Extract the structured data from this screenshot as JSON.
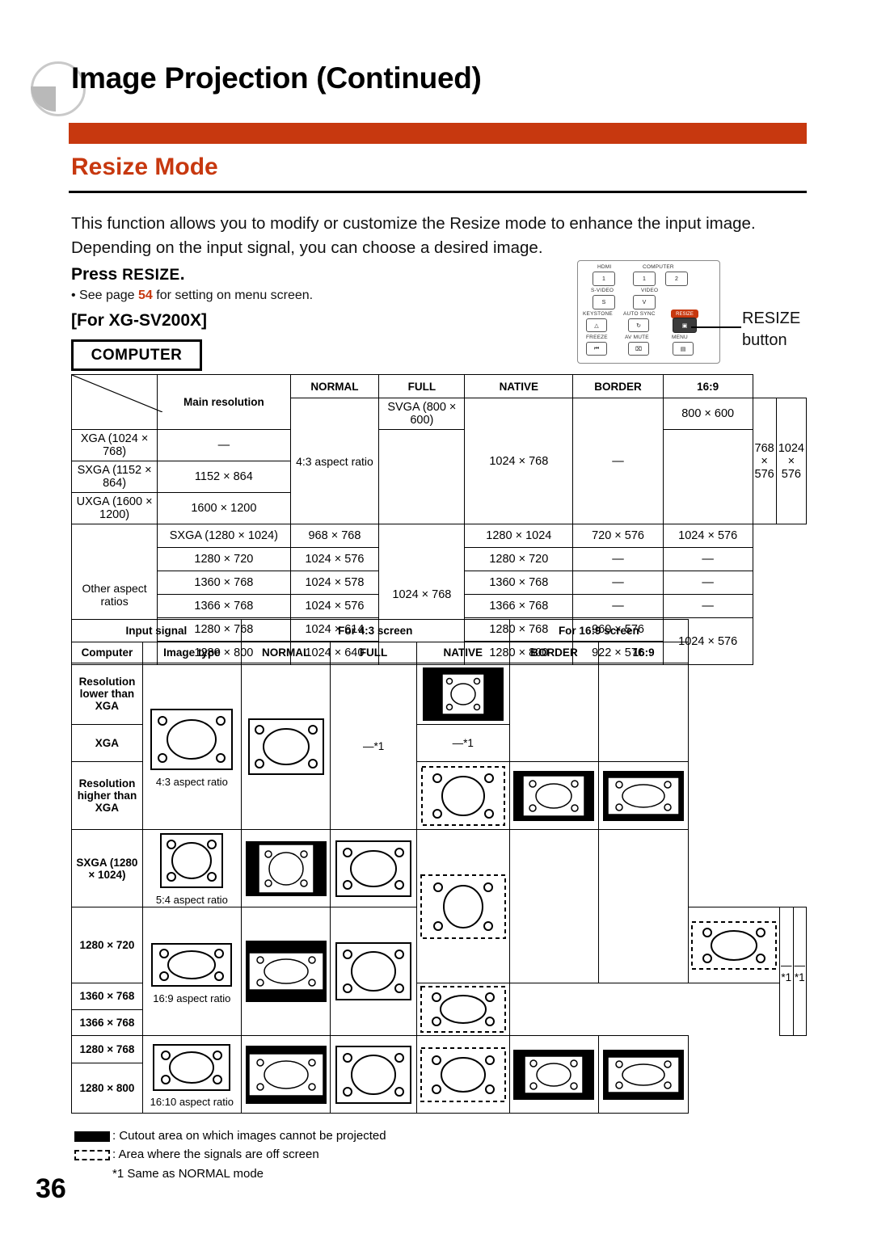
{
  "header": {
    "title": "Image Projection (Continued)",
    "section": "Resize Mode"
  },
  "intro": "This function allows you to modify or customize the Resize mode to enhance the input image. Depending on the input signal, you can choose a desired image.",
  "press": {
    "prefix": "Press ",
    "key": "RESIZE",
    "suffix": ".",
    "note_before": "• See page ",
    "note_page": "54",
    "note_after": " for setting on menu screen.",
    "for_model": "[For XG-SV200X]",
    "computer_badge": "COMPUTER"
  },
  "remote": {
    "labels": {
      "hdmi": "HDMI",
      "computer": "COMPUTER",
      "svideo": "S-VIDEO",
      "video": "VIDEO",
      "keystone": "KEYSTONE",
      "autosync": "AUTO SYNC",
      "resize": "RESIZE",
      "freeze": "FREEZE",
      "avmute": "AV MUTE",
      "menu": "MENU"
    },
    "keys": {
      "hdmi": "1",
      "computer1": "1",
      "computer2": "2",
      "svideo": "S",
      "video": "V",
      "keystone": "△",
      "autosync": "↻",
      "resize": "▣",
      "freeze": "⏮",
      "avmute": "⌧",
      "menu": "▤"
    },
    "callout": "RESIZE\nbutton",
    "callout_line1": "RESIZE",
    "callout_line2": "button"
  },
  "table1": {
    "headers": [
      "Main resolution",
      "NORMAL",
      "FULL",
      "NATIVE",
      "BORDER",
      "16:9"
    ],
    "group1_label": "4:3 aspect ratio",
    "group2_label": "Other aspect ratios",
    "rows_group1": [
      {
        "res": "SVGA (800 × 600)",
        "native": "800 × 600"
      },
      {
        "res": "XGA (1024 × 768)",
        "native": "—"
      },
      {
        "res": "SXGA (1152 × 864)",
        "native": "1152 × 864"
      },
      {
        "res": "UXGA (1600 × 1200)",
        "native": "1600 × 1200"
      }
    ],
    "group1_normal": "1024 × 768",
    "group1_full": "—",
    "group1_border": "768 × 576",
    "group1_169": "1024 × 576",
    "rows_group2": [
      {
        "res": "SXGA (1280 × 1024)",
        "normal": "968 × 768",
        "native": "1280 × 1024",
        "border": "720 × 576",
        "r169": ""
      },
      {
        "res": "1280 × 720",
        "normal": "1024 × 576",
        "native": "1280 × 720",
        "border": "—",
        "r169": "—"
      },
      {
        "res": "1360 × 768",
        "normal": "1024 × 578",
        "native": "1360 × 768",
        "border": "—",
        "r169": "—"
      },
      {
        "res": "1366 × 768",
        "normal": "1024 × 576",
        "native": "1366 × 768",
        "border": "—",
        "r169": "—"
      },
      {
        "res": "1280 × 768",
        "normal": "1024 × 614",
        "native": "1280 × 768",
        "border": "960 × 576",
        "r169": ""
      },
      {
        "res": "1280 × 800",
        "normal": "1024 × 640",
        "native": "1280 × 800",
        "border": "922 × 576",
        "r169": ""
      }
    ],
    "group2_full": "1024 × 768",
    "sxga_169": "1024 × 576",
    "bottom_169": "1024 × 576"
  },
  "table2": {
    "group_headers": [
      "Input signal",
      "For 4:3 screen",
      "For 16:9 screen"
    ],
    "sub_headers": [
      "Computer",
      "Image type",
      "NORMAL",
      "FULL",
      "NATIVE",
      "BORDER",
      "16:9"
    ],
    "rows": [
      {
        "label": "Resolution\nlower than\nXGA",
        "l1": "Resolution",
        "l2": "lower than",
        "l3": "XGA",
        "caption": "4:3 aspect ratio"
      },
      {
        "label": "XGA",
        "l1": "XGA",
        "l2": "",
        "l3": "",
        "caption": ""
      },
      {
        "label": "Resolution\nhigher than\nXGA",
        "l1": "Resolution",
        "l2": "higher than",
        "l3": "XGA",
        "caption": ""
      },
      {
        "label": "SXGA (1280 × 1024)",
        "l1": "SXGA (1280 × 1024)",
        "l2": "",
        "l3": "",
        "caption": "5:4 aspect ratio"
      },
      {
        "label": "1280 × 720",
        "l1": "1280 × 720",
        "l2": "",
        "l3": "",
        "caption": "16:9 aspect ratio"
      },
      {
        "label": "1360 × 768",
        "l1": "1360 × 768",
        "l2": "",
        "l3": "",
        "caption": ""
      },
      {
        "label": "1366 × 768",
        "l1": "1366 × 768",
        "l2": "",
        "l3": "",
        "caption": ""
      },
      {
        "label": "1280 × 768",
        "l1": "1280 × 768",
        "l2": "",
        "l3": "",
        "caption": ""
      },
      {
        "label": "1280 × 800",
        "l1": "1280 × 800",
        "l2": "",
        "l3": "",
        "caption": "16:10 aspect ratio"
      }
    ],
    "same_as_normal_mark": "—*1"
  },
  "legend": {
    "line1": ": Cutout area on which images cannot be projected",
    "line2": ": Area where the signals are off screen",
    "line3": "*1 Same as NORMAL mode"
  },
  "folio": "36",
  "colors": {
    "accent": "#c7380f",
    "text": "#000000"
  }
}
